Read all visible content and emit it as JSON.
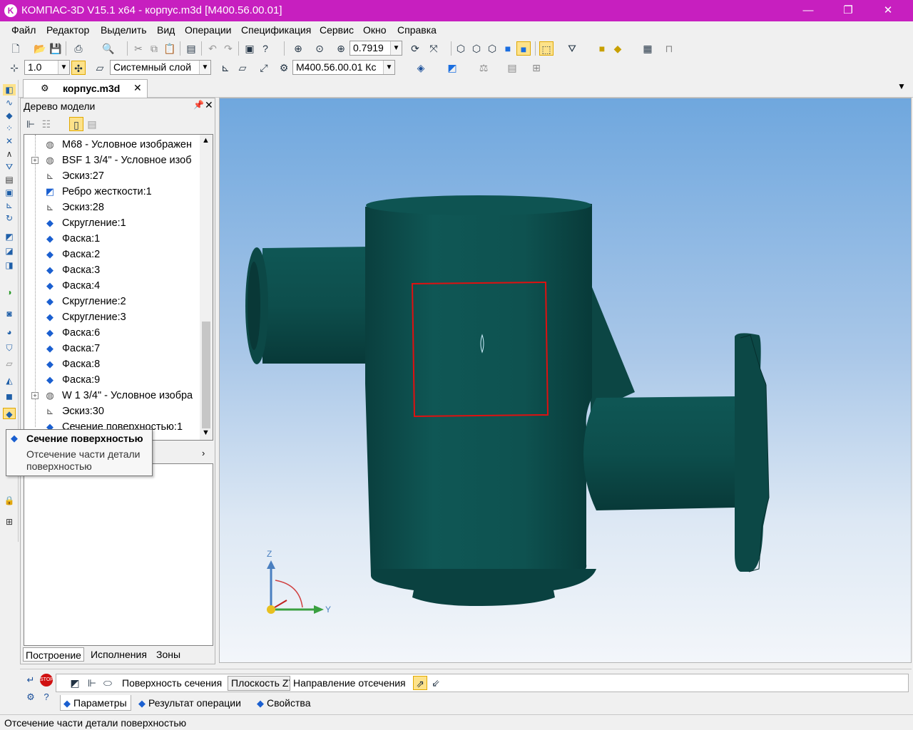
{
  "window": {
    "title": "КОМПАС-3D V15.1 x64 - корпус.m3d [M400.56.00.01]",
    "controls": {
      "minimize": "—",
      "maximize": "❐",
      "close": "✕"
    }
  },
  "menu": [
    "Файл",
    "Редактор",
    "Выделить",
    "Вид",
    "Операции",
    "Спецификация",
    "Сервис",
    "Окно",
    "Справка"
  ],
  "toolbar": {
    "zoom_value": "0.7919",
    "step_value": "1.0",
    "layer": "Системный слой",
    "designation": "M400.56.00.01 Кс"
  },
  "doc_tab": {
    "label": "корпус.m3d"
  },
  "model_tree": {
    "title": "Дерево модели",
    "items": [
      {
        "label": "M68 - Условное изображен",
        "icon": "thread-icon",
        "expandable": false
      },
      {
        "label": "BSF 1 3/4\" - Условное изоб",
        "icon": "thread-icon",
        "expandable": true
      },
      {
        "label": "Эскиз:27",
        "icon": "sketch-icon",
        "expandable": false
      },
      {
        "label": "Ребро жесткости:1",
        "icon": "rib-icon",
        "expandable": false
      },
      {
        "label": "Эскиз:28",
        "icon": "sketch-icon",
        "expandable": false
      },
      {
        "label": "Скругление:1",
        "icon": "fillet-icon",
        "expandable": false
      },
      {
        "label": "Фаска:1",
        "icon": "chamfer-icon",
        "expandable": false
      },
      {
        "label": "Фаска:2",
        "icon": "chamfer-icon",
        "expandable": false
      },
      {
        "label": "Фаска:3",
        "icon": "chamfer-icon",
        "expandable": false
      },
      {
        "label": "Фаска:4",
        "icon": "chamfer-icon",
        "expandable": false
      },
      {
        "label": "Скругление:2",
        "icon": "fillet-icon",
        "expandable": false
      },
      {
        "label": "Скругление:3",
        "icon": "fillet-icon",
        "expandable": false
      },
      {
        "label": "Фаска:6",
        "icon": "chamfer-icon",
        "expandable": false
      },
      {
        "label": "Фаска:7",
        "icon": "chamfer-icon",
        "expandable": false
      },
      {
        "label": "Фаска:8",
        "icon": "chamfer-icon",
        "expandable": false
      },
      {
        "label": "Фаска:9",
        "icon": "chamfer-icon",
        "expandable": false
      },
      {
        "label": "W 1 3/4\" - Условное изобра",
        "icon": "thread-icon",
        "expandable": true
      },
      {
        "label": "Эскиз:30",
        "icon": "sketch-icon",
        "expandable": false
      },
      {
        "label": "Сечение поверхностью:1",
        "icon": "section-icon",
        "expandable": false
      }
    ],
    "tabs": [
      "Построение",
      "Исполнения",
      "Зоны"
    ]
  },
  "tooltip": {
    "title": "Сечение поверхностью",
    "description": "Отсечение части детали поверхностью"
  },
  "viewport": {
    "axes": {
      "z": "Z",
      "y": "Y"
    },
    "model_color": "#0d4a48",
    "selection_color": "#e01010"
  },
  "properties": {
    "surface_label": "Поверхность сечения",
    "surface_value": "Плоскость ZY",
    "direction_label": "Направление отсечения",
    "tabs": [
      "Параметры",
      "Результат операции",
      "Свойства"
    ]
  },
  "status": "Отсечение части детали поверхностью",
  "colors": {
    "titlebar": "#c71fbf",
    "tree_icon": "#1a5fd0"
  }
}
